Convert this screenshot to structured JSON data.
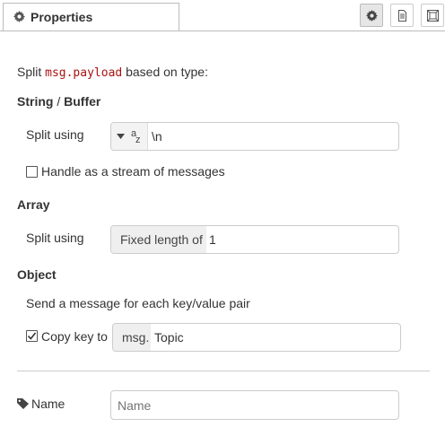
{
  "tabs": {
    "active_label": "Properties"
  },
  "toolbar_icons": [
    "gear-icon",
    "document-icon",
    "expand-icon"
  ],
  "intro": {
    "prefix": "Split ",
    "code": "msg.payload",
    "suffix": " based on type:"
  },
  "string_section": {
    "heading_a": "String",
    "heading_sep": " / ",
    "heading_b": "Buffer",
    "split_label": "Split using",
    "type_icon_sup": "a",
    "type_icon_sub": "z",
    "split_value": "\\n",
    "stream_label": "Handle as a stream of messages",
    "stream_checked": false
  },
  "array_section": {
    "heading": "Array",
    "split_label": "Split using",
    "prefix": "Fixed length of",
    "value": "1"
  },
  "object_section": {
    "heading": "Object",
    "description": "Send a message for each key/value pair",
    "copy_label": "Copy key to",
    "copy_checked": true,
    "prefix": "msg.",
    "value": "Topic"
  },
  "name_field": {
    "label": "Name",
    "placeholder": "Name",
    "value": ""
  },
  "colors": {
    "code_red": "#aa1111",
    "border": "#cccccc",
    "prefix_bg": "#efefef"
  }
}
